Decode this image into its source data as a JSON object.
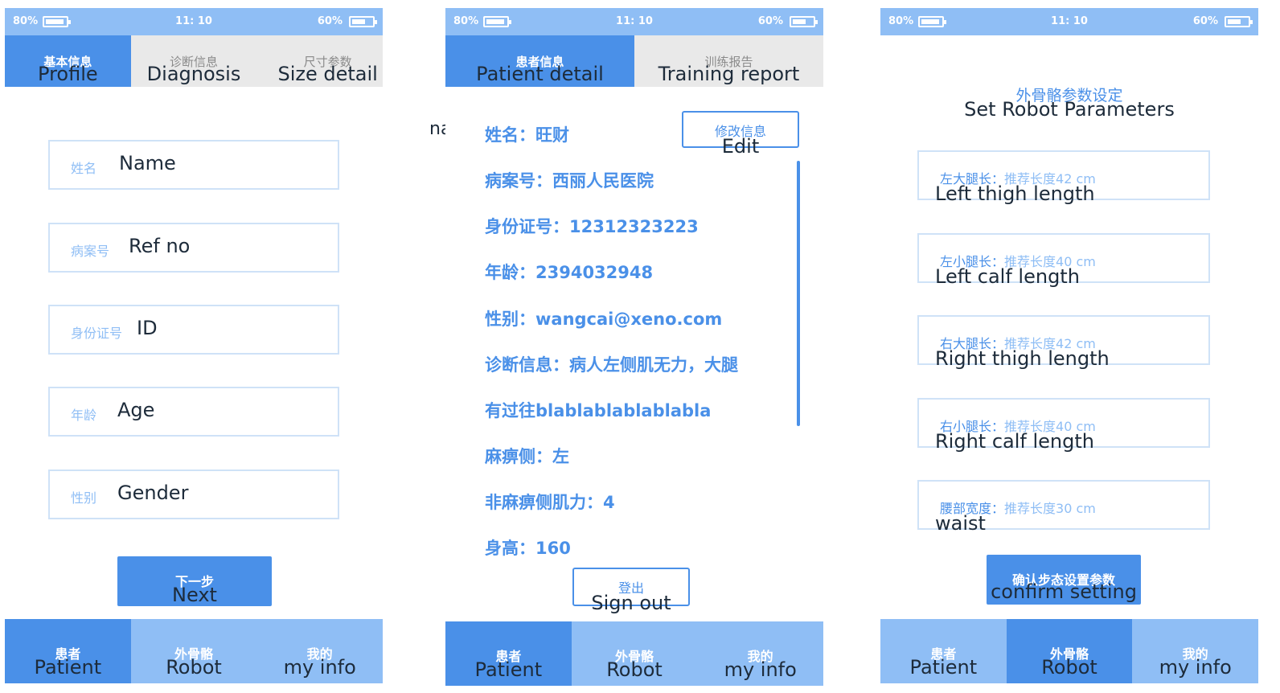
{
  "status_bar": {
    "battery_left": "80%",
    "time": "11: 10",
    "battery_right": "60%"
  },
  "screen_profile": {
    "tabs": [
      {
        "cn": "基本信息",
        "en": "Profile"
      },
      {
        "cn": "诊断信息",
        "en": "Diagnosis"
      },
      {
        "cn": "尺寸参数",
        "en": "Size detail"
      }
    ],
    "fields": [
      {
        "cn": "姓名",
        "en": "Name"
      },
      {
        "cn": "病案号",
        "en": "Ref no"
      },
      {
        "cn": "身份证号",
        "en": "ID"
      },
      {
        "cn": "年龄",
        "en": "Age"
      },
      {
        "cn": "性别",
        "en": "Gender"
      }
    ],
    "next_button": {
      "cn": "下一步",
      "en": "Next"
    }
  },
  "screen_patient_detail": {
    "outside_label": "name",
    "tabs": [
      {
        "cn": "患者信息",
        "en": "Patient detail"
      },
      {
        "cn": "训练报告",
        "en": "Training report"
      }
    ],
    "edit_button": {
      "cn": "修改信息",
      "en": "Edit"
    },
    "lines": [
      "姓名：旺财",
      "病案号：西丽人民医院",
      "身份证号：12312323223",
      "年龄：2394032948",
      "性别：wangcai@xeno.com",
      "诊断信息：病人左侧肌无力，大腿",
      "有过往blablablablablabla",
      "麻痹侧：左",
      "非麻痹侧肌力：4",
      "身高：160"
    ],
    "signout_button": {
      "cn": "登出",
      "en": "Sign out"
    }
  },
  "screen_robot_params": {
    "title_cn": "外骨骼参数设定",
    "title_en": "Set Robot Parameters",
    "params": [
      {
        "cn": "左大腿长：",
        "hint": "推荐长度42 cm",
        "en": "Left thigh length"
      },
      {
        "cn": "左小腿长：",
        "hint": "推荐长度40 cm",
        "en": "Left calf length"
      },
      {
        "cn": "右大腿长：",
        "hint": "推荐长度42 cm",
        "en": "Right thigh length"
      },
      {
        "cn": "右小腿长：",
        "hint": "推荐长度40 cm",
        "en": "Right calf length"
      },
      {
        "cn": "腰部宽度：",
        "hint": "推荐长度30 cm",
        "en": "waist"
      }
    ],
    "confirm_button": {
      "cn": "确认步态设置参数",
      "en": "confirm setting"
    }
  },
  "bottom_nav": [
    {
      "cn": "患者",
      "en": "Patient"
    },
    {
      "cn": "外骨骼",
      "en": "Robot"
    },
    {
      "cn": "我的",
      "en": "my info"
    }
  ],
  "colors": {
    "primary": "#4a90e8",
    "light": "#8fbef5",
    "tab_bg": "#e9e9e9",
    "text": "#1d2b3a"
  }
}
